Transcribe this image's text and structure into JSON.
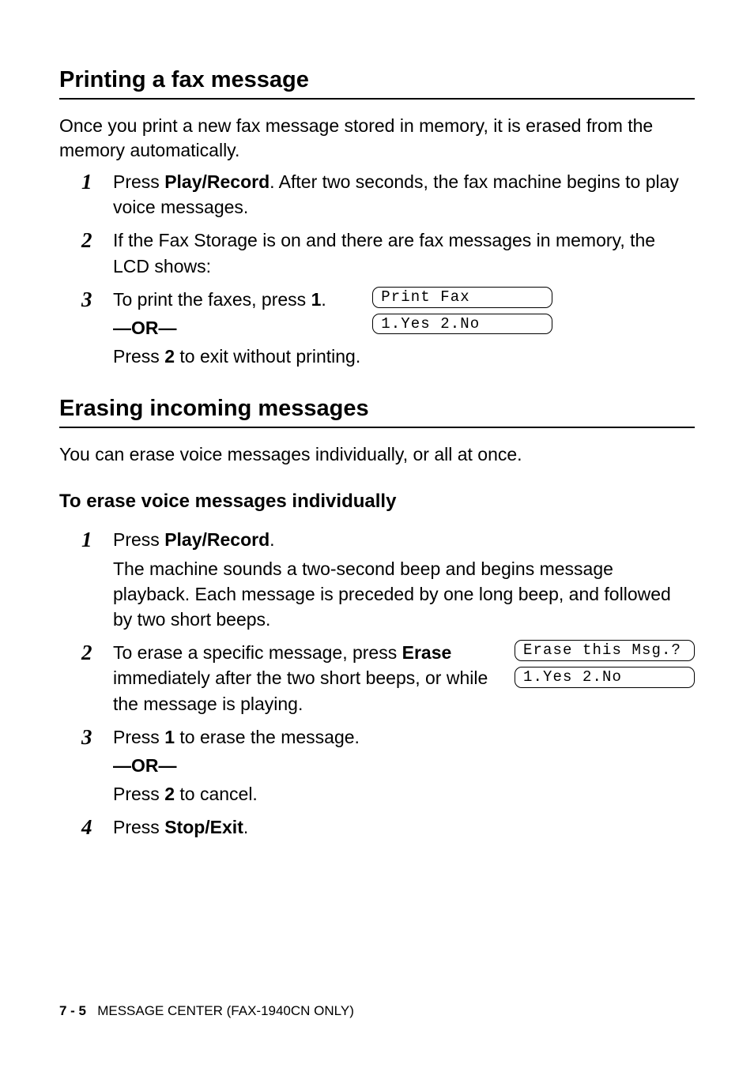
{
  "section1": {
    "heading": "Printing a fax message",
    "intro": "Once you print a new fax message stored in memory, it is erased from the memory automatically.",
    "steps": {
      "s1": {
        "num": "1",
        "text_a": "Press ",
        "key": "Play/Record",
        "text_b": ". After two seconds, the fax machine begins to play voice messages."
      },
      "s2": {
        "num": "2",
        "text": "If the Fax Storage is on and there are fax messages in memory, the LCD shows:"
      },
      "s3": {
        "num": "3",
        "text_a": "To print the faxes, press ",
        "key1": "1",
        "text_b": ".",
        "or": "—OR—",
        "text_c": "Press ",
        "key2": "2",
        "text_d": " to exit without printing."
      }
    },
    "lcd": {
      "line1": "Print Fax",
      "line2": "1.Yes 2.No"
    }
  },
  "section2": {
    "heading": "Erasing incoming messages",
    "intro": "You can erase voice messages individually, or all at once.",
    "subheading": "To erase voice messages individually",
    "steps": {
      "s1": {
        "num": "1",
        "text_a": "Press ",
        "key": "Play/Record",
        "text_b": ".",
        "para": "The machine sounds a two-second beep and begins message playback. Each message is preceded by one long beep, and followed by two short beeps."
      },
      "s2": {
        "num": "2",
        "text_a": "To erase a specific message, press ",
        "key": "Erase",
        "text_b": " immediately after the two short beeps, or while the message is playing."
      },
      "s3": {
        "num": "3",
        "text_a": "Press ",
        "key1": "1",
        "text_b": " to erase the message.",
        "or": "—OR—",
        "text_c": "Press ",
        "key2": "2",
        "text_d": " to cancel."
      },
      "s4": {
        "num": "4",
        "text_a": "Press ",
        "key": "Stop/Exit",
        "text_b": "."
      }
    },
    "lcd": {
      "line1": "Erase this Msg.?",
      "line2": "1.Yes 2.No"
    }
  },
  "footer": {
    "page": "7 - 5",
    "title": "MESSAGE CENTER (FAX-1940CN ONLY)"
  }
}
